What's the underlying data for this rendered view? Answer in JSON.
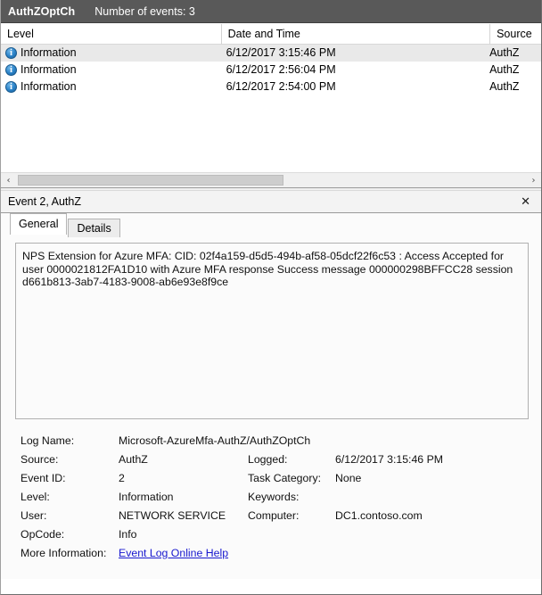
{
  "channel_header": {
    "name": "AuthZOptCh",
    "event_count_label": "Number of events: 3"
  },
  "event_list": {
    "columns": [
      "Level",
      "Date and Time",
      "Source"
    ],
    "rows": [
      {
        "icon": "info-icon",
        "level": "Information",
        "datetime": "6/12/2017 3:15:46 PM",
        "source": "AuthZ",
        "selected": true
      },
      {
        "icon": "info-icon",
        "level": "Information",
        "datetime": "6/12/2017 2:56:04 PM",
        "source": "AuthZ",
        "selected": false
      },
      {
        "icon": "info-icon",
        "level": "Information",
        "datetime": "6/12/2017 2:54:00 PM",
        "source": "AuthZ",
        "selected": false
      }
    ],
    "info_glyph": "i",
    "scrollbar": {
      "left_arrow": "‹",
      "right_arrow": "›"
    }
  },
  "detail_pane": {
    "title": "Event 2, AuthZ",
    "close_label": "✕",
    "tabs": [
      {
        "label": "General",
        "active": true
      },
      {
        "label": "Details",
        "active": false
      }
    ],
    "message": "NPS Extension for Azure MFA:  CID: 02f4a159-d5d5-494b-af58-05dcf22f6c53 : Access Accepted for user 0000021812FA1D10 with Azure MFA response Success message 000000298BFFCC28 session d661b813-3ab7-4183-9008-ab6e93e8f9ce",
    "fields": {
      "log_name_label": "Log Name:",
      "log_name_value": "Microsoft-AzureMfa-AuthZ/AuthZOptCh",
      "source_label": "Source:",
      "source_value": "AuthZ",
      "logged_label": "Logged:",
      "logged_value": "6/12/2017 3:15:46 PM",
      "event_id_label": "Event ID:",
      "event_id_value": "2",
      "task_category_label": "Task Category:",
      "task_category_value": "None",
      "level_label": "Level:",
      "level_value": "Information",
      "keywords_label": "Keywords:",
      "keywords_value": "",
      "user_label": "User:",
      "user_value": "NETWORK SERVICE",
      "computer_label": "Computer:",
      "computer_value": "DC1.contoso.com",
      "opcode_label": "OpCode:",
      "opcode_value": "Info",
      "more_info_label": "More Information:",
      "more_info_link": "Event Log Online Help"
    }
  },
  "colors": {
    "header_bg": "#595959",
    "header_fg": "#ffffff",
    "selection_bg": "#e9e9e9",
    "info_icon": "#2a82c8",
    "link": "#1818cf"
  }
}
